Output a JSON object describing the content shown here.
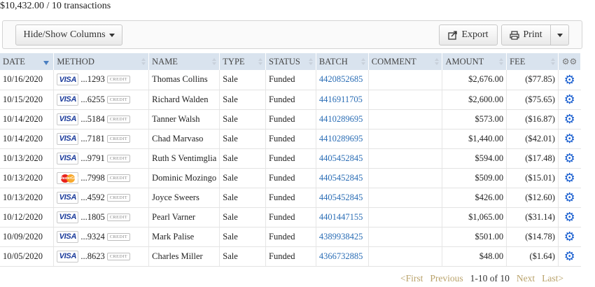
{
  "summary": {
    "text": "$10,432.00 / 10 transactions"
  },
  "toolbar": {
    "hide_show_label": "Hide/Show Columns",
    "export_label": "Export",
    "print_label": "Print"
  },
  "columns": [
    "DATE",
    "METHOD",
    "NAME",
    "TYPE",
    "STATUS",
    "BATCH",
    "COMMENT",
    "AMOUNT",
    "FEE"
  ],
  "rows": [
    {
      "date": "10/16/2020",
      "card": "visa",
      "last4": "...1293",
      "credit": "CREDIT",
      "name": "Thomas Collins",
      "type": "Sale",
      "status": "Funded",
      "batch": "4420852685",
      "comment": "",
      "amount": "$2,676.00",
      "fee": "($77.85)"
    },
    {
      "date": "10/15/2020",
      "card": "visa",
      "last4": "...6255",
      "credit": "CREDIT",
      "name": "Richard Walden",
      "type": "Sale",
      "status": "Funded",
      "batch": "4416911705",
      "comment": "",
      "amount": "$2,600.00",
      "fee": "($75.65)"
    },
    {
      "date": "10/14/2020",
      "card": "visa",
      "last4": "...5184",
      "credit": "CREDIT",
      "name": "Tanner Walsh",
      "type": "Sale",
      "status": "Funded",
      "batch": "4410289695",
      "comment": "",
      "amount": "$573.00",
      "fee": "($16.87)"
    },
    {
      "date": "10/14/2020",
      "card": "visa",
      "last4": "...7181",
      "credit": "CREDIT",
      "name": "Chad Marvaso",
      "type": "Sale",
      "status": "Funded",
      "batch": "4410289695",
      "comment": "",
      "amount": "$1,440.00",
      "fee": "($42.01)"
    },
    {
      "date": "10/13/2020",
      "card": "visa",
      "last4": "...9791",
      "credit": "CREDIT",
      "name": "Ruth S Ventimglia",
      "type": "Sale",
      "status": "Funded",
      "batch": "4405452845",
      "comment": "",
      "amount": "$594.00",
      "fee": "($17.48)"
    },
    {
      "date": "10/13/2020",
      "card": "mastercard",
      "last4": "...7998",
      "credit": "CREDIT",
      "name": "Dominic Mozingo",
      "type": "Sale",
      "status": "Funded",
      "batch": "4405452845",
      "comment": "",
      "amount": "$509.00",
      "fee": "($15.01)"
    },
    {
      "date": "10/13/2020",
      "card": "visa",
      "last4": "...4592",
      "credit": "CREDIT",
      "name": "Joyce Sweers",
      "type": "Sale",
      "status": "Funded",
      "batch": "4405452845",
      "comment": "",
      "amount": "$426.00",
      "fee": "($12.60)"
    },
    {
      "date": "10/12/2020",
      "card": "visa",
      "last4": "...1805",
      "credit": "CREDIT",
      "name": "Pearl Varner",
      "type": "Sale",
      "status": "Funded",
      "batch": "4401447155",
      "comment": "",
      "amount": "$1,065.00",
      "fee": "($31.14)"
    },
    {
      "date": "10/09/2020",
      "card": "visa",
      "last4": "...9324",
      "credit": "CREDIT",
      "name": "Mark Palise",
      "type": "Sale",
      "status": "Funded",
      "batch": "4389938425",
      "comment": "",
      "amount": "$501.00",
      "fee": "($14.78)"
    },
    {
      "date": "10/05/2020",
      "card": "visa",
      "last4": "...8623",
      "credit": "CREDIT",
      "name": "Charles Miller",
      "type": "Sale",
      "status": "Funded",
      "batch": "4366732885",
      "comment": "",
      "amount": "$48.00",
      "fee": "($1.64)"
    }
  ],
  "card_labels": {
    "visa": "VISA",
    "mastercard": "MasterCard"
  },
  "pager": {
    "first": "<First",
    "previous": "Previous",
    "range": "1-10 of 10",
    "next": "Next",
    "last": "Last>"
  },
  "colors": {
    "header_bg": "#d9e3ee",
    "link": "#2a6db5",
    "gear": "#1a5fd0",
    "pager_link": "#b9a26a"
  },
  "icons": {
    "export": "export-icon",
    "print": "print-icon",
    "row_action": "gear-icon",
    "header_action": "gears-icon"
  },
  "sort": {
    "column": "DATE",
    "direction": "desc"
  }
}
